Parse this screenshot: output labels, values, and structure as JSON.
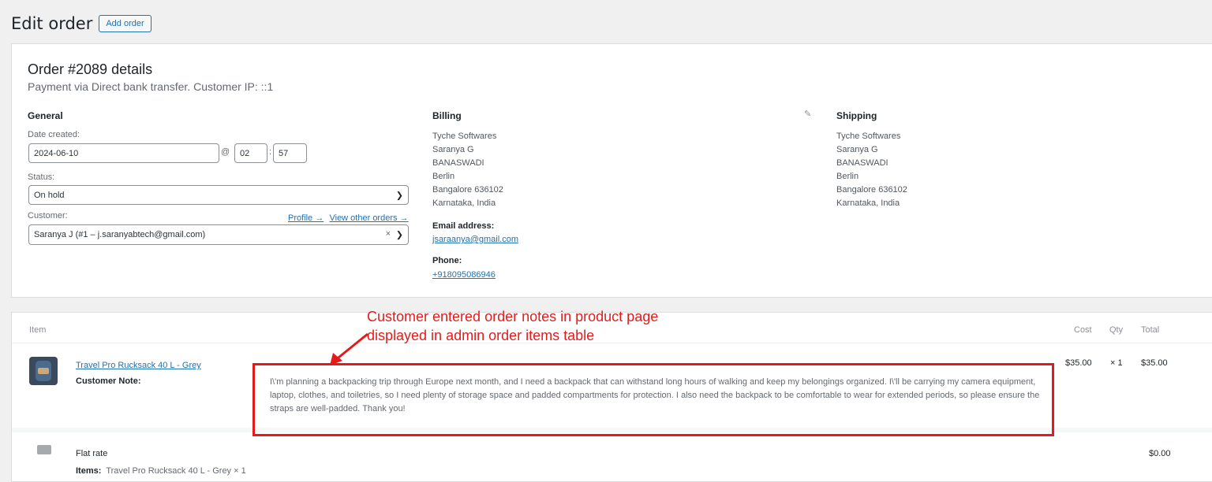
{
  "header": {
    "title": "Edit order",
    "add_button": "Add order"
  },
  "order": {
    "title": "Order #2089 details",
    "subtitle": "Payment via Direct bank transfer. Customer IP: ::1"
  },
  "general": {
    "heading": "General",
    "date_label": "Date created:",
    "date": "2024-06-10",
    "at": "@",
    "hour": "02",
    "colon": ":",
    "minute": "57",
    "status_label": "Status:",
    "status": "On hold",
    "customer_label": "Customer:",
    "profile_link": "Profile →",
    "other_orders_link": "View other orders →",
    "customer": "Saranya J (#1 – j.saranyabtech@gmail.com)",
    "clear": "×"
  },
  "billing": {
    "heading": "Billing",
    "lines": [
      "Tyche Softwares",
      "Saranya G",
      "BANASWADI",
      "Berlin",
      "Bangalore 636102",
      "Karnataka, India"
    ],
    "email_label": "Email address:",
    "email": "jsaraanya@gmail.com",
    "phone_label": "Phone:",
    "phone": "+918095086946"
  },
  "shipping": {
    "heading": "Shipping",
    "lines": [
      "Tyche Softwares",
      "Saranya G",
      "BANASWADI",
      "Berlin",
      "Bangalore 636102",
      "Karnataka, India"
    ]
  },
  "items_table": {
    "headers": {
      "item": "Item",
      "cost": "Cost",
      "qty": "Qty",
      "total": "Total"
    },
    "product": {
      "name": "Travel Pro Rucksack 40 L - Grey",
      "note_label": "Customer Note:",
      "note": "I\\'m planning a backpacking trip through Europe next month, and I need a backpack that can withstand long hours of walking and keep my belongings organized. I\\'ll be carrying my camera equipment, laptop, clothes, and toiletries, so I need plenty of storage space and padded compartments for protection. I also need the backpack to be comfortable to wear for extended periods, so please ensure the straps are well-padded. Thank you!",
      "cost": "$35.00",
      "qty": "× 1",
      "total": "$35.00"
    },
    "shipping": {
      "name": "Flat rate",
      "items_label": "Items:",
      "items": "Travel Pro Rucksack 40 L - Grey × 1",
      "total": "$0.00"
    }
  },
  "annotation": {
    "line1": "Customer entered order notes in product page",
    "line2": "displayed in admin order items table",
    "color": "#e51b1b"
  }
}
